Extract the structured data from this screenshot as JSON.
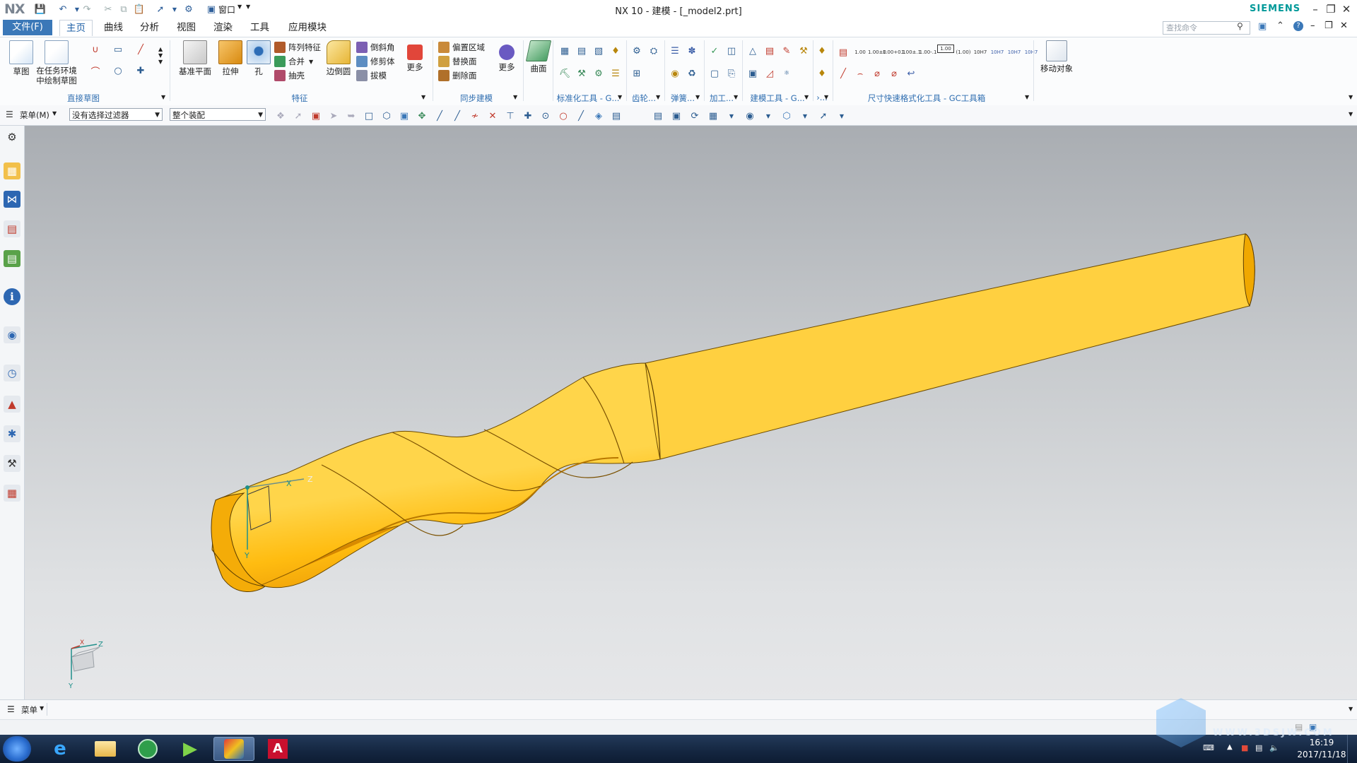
{
  "app": {
    "logo": "NX",
    "window_title": "NX 10 - 建模 - [_model2.prt]",
    "brand": "SIEMENS",
    "window_menu": "窗口"
  },
  "menu_tabs": {
    "file": "文件(F)",
    "tabs": [
      "主页",
      "曲线",
      "分析",
      "视图",
      "渲染",
      "工具",
      "应用模块"
    ],
    "active": "主页",
    "search_placeholder": "查找命令"
  },
  "ribbon": {
    "direct_sketch": {
      "label": "直接草图",
      "sketch": "草图",
      "task_sketch": "在任务环境中绘制草图"
    },
    "feature": {
      "label": "特征",
      "datum_plane": "基准平面",
      "extrude": "拉伸",
      "hole": "孔",
      "pattern": "阵列特征",
      "unite": "合并",
      "shell": "抽壳",
      "edge_blend": "边倒圆",
      "chamfer": "倒斜角",
      "trim_body": "修剪体",
      "draft": "拔模",
      "more": "更多"
    },
    "sync": {
      "label": "同步建模",
      "offset_region": "偏置区域",
      "replace_face": "替换面",
      "delete_face": "删除面",
      "more": "更多"
    },
    "surface": {
      "label": "曲面"
    },
    "std_tools": {
      "label": "标准化工具 - G..."
    },
    "gear": {
      "label": "齿轮..."
    },
    "spring": {
      "label": "弹簧..."
    },
    "machining": {
      "label": "加工..."
    },
    "modeling_tools": {
      "label": "建模工具 - G..."
    },
    "misc": {
      "label": "›..."
    },
    "dim_tools": {
      "label": "尺寸快速格式化工具 - GC工具箱",
      "items": [
        "1.00",
        "1.00±0",
        "1.00+0.1",
        "1.00±.1",
        "1.00-.1",
        "1.00",
        "(1.00)",
        "10H7",
        "10H7",
        "10H7",
        "10H7"
      ]
    },
    "move_object": "移动对象"
  },
  "selection_bar": {
    "menu": "菜单(M)",
    "filter": "没有选择过滤器",
    "scope": "整个装配"
  },
  "triad": {
    "x": "X",
    "y": "Y",
    "z": "Z"
  },
  "statusbar": {
    "menu": "菜单"
  },
  "taskbar": {
    "time": "16:19",
    "date": "2017/11/18"
  },
  "watermark": {
    "text": "WWW.3DSJW.COM"
  },
  "colors": {
    "accent": "#3b78b8",
    "model": "#f5a800",
    "siemens": "#009999"
  }
}
